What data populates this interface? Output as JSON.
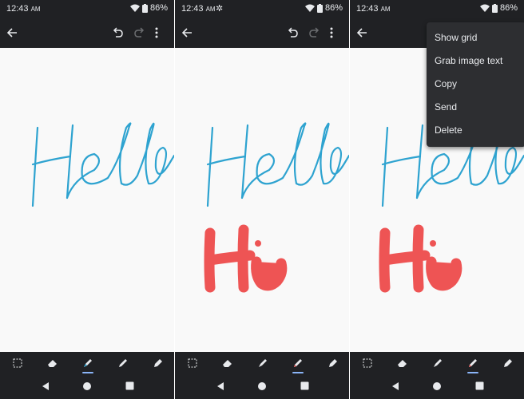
{
  "status": {
    "time": "12:43",
    "ampm": "AM",
    "battery": "86%"
  },
  "menu": {
    "items": [
      "Show grid",
      "Grab image text",
      "Copy",
      "Send",
      "Delete"
    ]
  },
  "drawing": {
    "hello_color": "#2ea3d0",
    "hi_color": "#ee5454"
  },
  "colors": {
    "chrome": "#202124",
    "menu_bg": "#2d2e31",
    "canvas": "#f9f9f9",
    "active_tool": "#8ab4f8"
  },
  "icons": {
    "status": [
      "wifi-icon",
      "battery-icon"
    ],
    "appbar": [
      "back-arrow-icon",
      "undo-icon",
      "redo-icon",
      "more-vert-icon"
    ],
    "tools": [
      "lasso-select-icon",
      "eraser-icon",
      "marker-icon",
      "pen-icon",
      "highlighter-icon"
    ],
    "nav": [
      "nav-back-icon",
      "nav-home-icon",
      "nav-recents-icon"
    ]
  }
}
